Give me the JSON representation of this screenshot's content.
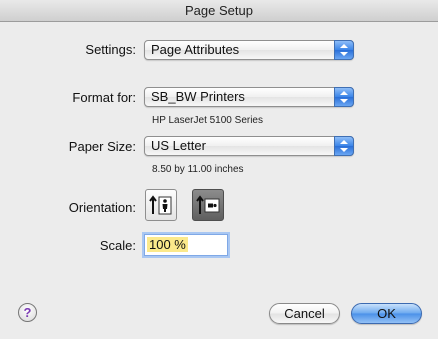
{
  "window": {
    "title": "Page Setup"
  },
  "settings": {
    "label": "Settings:",
    "value": "Page Attributes"
  },
  "format_for": {
    "label": "Format for:",
    "value": "SB_BW Printers",
    "detail": "HP LaserJet 5100 Series"
  },
  "paper_size": {
    "label": "Paper Size:",
    "value": "US Letter",
    "detail": "8.50 by 11.00 inches"
  },
  "orientation": {
    "label": "Orientation:",
    "options": [
      {
        "name": "portrait",
        "selected": false
      },
      {
        "name": "landscape",
        "selected": true
      }
    ]
  },
  "scale": {
    "label": "Scale:",
    "value": "100 %"
  },
  "footer": {
    "help_symbol": "?",
    "cancel_label": "Cancel",
    "ok_label": "OK"
  },
  "colors": {
    "accent": "#3a84e8",
    "field_highlight": "#fbe98b",
    "help_icon": "#7a3ab4"
  }
}
